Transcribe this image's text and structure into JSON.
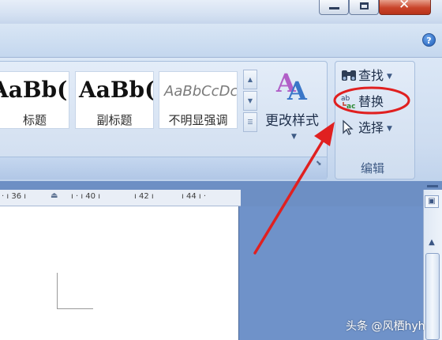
{
  "window": {
    "controls": [
      "minimize",
      "maximize",
      "close"
    ],
    "help_icon": "help-icon"
  },
  "ribbon": {
    "styles_gallery": [
      {
        "sample": "AaBb(",
        "name": "标题"
      },
      {
        "sample": "AaBb(",
        "name": "副标题"
      },
      {
        "sample": "AaBbCcDc",
        "name": "不明显强调"
      }
    ],
    "change_styles": {
      "label": "更改样式",
      "icon": "change-styles-icon"
    },
    "editing_group": {
      "label": "编辑",
      "find": {
        "label": "查找",
        "icon": "binoculars-icon"
      },
      "replace": {
        "label": "替换",
        "icon": "replace-icon"
      },
      "select": {
        "label": "选择",
        "icon": "cursor-arrow-icon"
      }
    }
  },
  "ruler": {
    "ticks": [
      "36",
      "40",
      "42",
      "44"
    ]
  },
  "annotation": {
    "highlight_color": "#e02020",
    "target": "替换"
  },
  "watermark": "头条 @风栖hyh"
}
